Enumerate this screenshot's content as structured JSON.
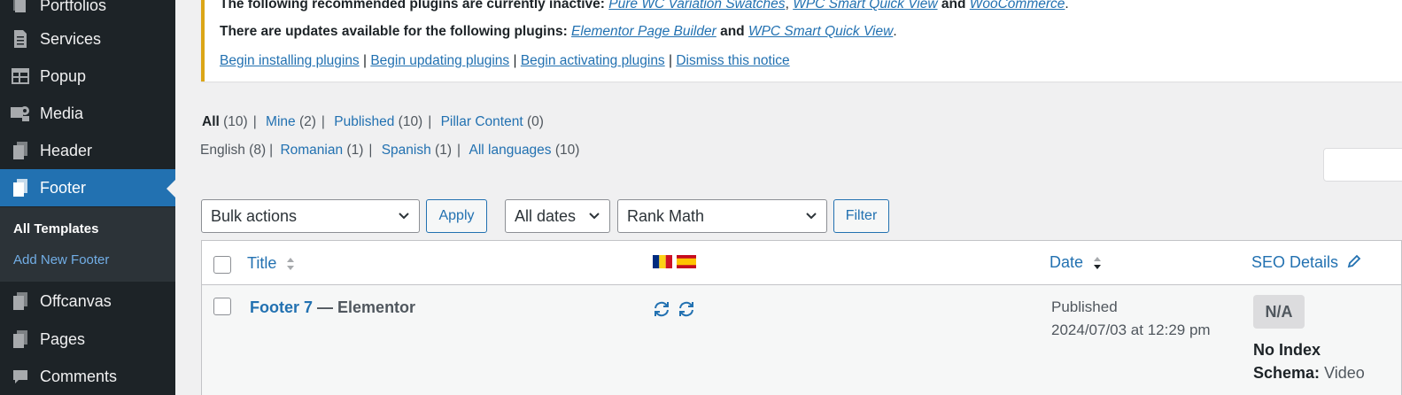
{
  "sidebar": {
    "items": [
      {
        "label": "Portfolios",
        "icon": "portfolio-icon"
      },
      {
        "label": "Services",
        "icon": "document-icon"
      },
      {
        "label": "Popup",
        "icon": "table-icon"
      },
      {
        "label": "Media",
        "icon": "media-icon"
      },
      {
        "label": "Header",
        "icon": "copy-icon"
      },
      {
        "label": "Footer",
        "icon": "copy-icon",
        "current": true
      },
      {
        "label": "Offcanvas",
        "icon": "copy-icon"
      },
      {
        "label": "Pages",
        "icon": "copy-icon"
      },
      {
        "label": "Comments",
        "icon": "comment-icon"
      }
    ],
    "submenu": {
      "all_templates": "All Templates",
      "add_new": "Add New Footer"
    }
  },
  "notice": {
    "line1_prefix": "The following recommended plugins are currently inactive:",
    "line1_links": [
      "Pure WC Variation Swatches",
      "WPC Smart Quick View",
      "WooCommerce"
    ],
    "line1_and": "and",
    "line2_prefix": "There are updates available for the following plugins:",
    "line2_links": [
      "Elementor Page Builder",
      "WPC Smart Quick View"
    ],
    "line2_and": "and",
    "actions": [
      "Begin installing plugins",
      "Begin updating plugins",
      "Begin activating plugins",
      "Dismiss this notice"
    ]
  },
  "status_filters": [
    {
      "label": "All",
      "count": "(10)",
      "current": true
    },
    {
      "label": "Mine",
      "count": "(2)"
    },
    {
      "label": "Published",
      "count": "(10)"
    },
    {
      "label": "Pillar Content",
      "count": "(0)"
    }
  ],
  "language_filters": [
    {
      "label": "English",
      "count": "(8)",
      "current": true
    },
    {
      "label": "Romanian",
      "count": "(1)"
    },
    {
      "label": "Spanish",
      "count": "(1)"
    },
    {
      "label": "All languages",
      "count": "(10)"
    }
  ],
  "tablenav": {
    "bulk_actions": "Bulk actions",
    "apply": "Apply",
    "all_dates": "All dates",
    "rank_math": "Rank Math",
    "filter": "Filter"
  },
  "table": {
    "columns": {
      "title": "Title",
      "date": "Date",
      "seo": "SEO Details"
    },
    "flags": [
      "romania-flag-icon",
      "spain-flag-icon"
    ],
    "rows": [
      {
        "title": "Footer 7",
        "suffix": "— Elementor",
        "status": "Published",
        "date": "2024/07/03 at 12:29 pm",
        "seo_score": "N/A",
        "index": "No Index",
        "schema_label": "Schema:",
        "schema_value": "Video"
      }
    ]
  },
  "colors": {
    "accent": "#2271b1",
    "sidebar": "#1d2327",
    "notice_border": "#dba617"
  }
}
